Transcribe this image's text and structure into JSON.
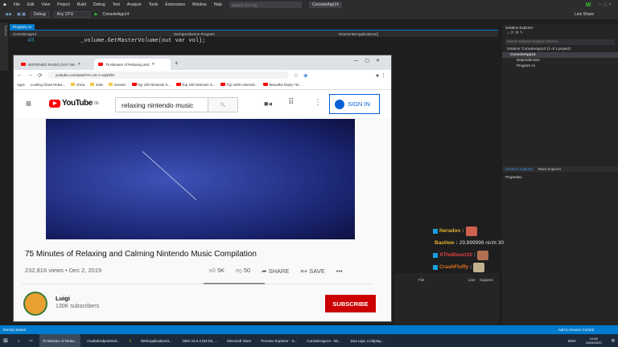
{
  "vs": {
    "menu": [
      "File",
      "Edit",
      "View",
      "Project",
      "Build",
      "Debug",
      "Test",
      "Analyze",
      "Tools",
      "Extensions",
      "Window",
      "Help"
    ],
    "search_placeholder": "Search (Ctrl+Q)",
    "project": "ConsoleApp14",
    "user_initial": "W",
    "live_share": "Live Share",
    "toolbar": {
      "config": "Debug",
      "platform": "Any CPU",
      "run": "ConsoleApp14"
    },
    "doc_tab": "Program.cs",
    "nav": {
      "project": "ConsoleApp14",
      "class": "SetAppVolumne.Program",
      "member": "EnumerateApplications()"
    },
    "code": {
      "line_no": "40",
      "line": "_volume.GetMasterVolume(out var vol);"
    },
    "toolbox": "Toolbox",
    "solution_explorer": {
      "title": "Solution Explorer",
      "search": "Search Solution Explorer (Ctrl+ü)",
      "tree": [
        "Solution 'ConsoleApp14' (1 of 1 project)",
        "ConsoleApp14",
        "Dependencies",
        "Program.cs"
      ],
      "tabs": [
        "Solution Explorer",
        "Team Explorer"
      ]
    },
    "properties": {
      "title": "Properties"
    },
    "error_cols": [
      "File",
      "Line",
      "Suppres"
    ],
    "status": {
      "left": "Item(s) Saved",
      "right": "Add to Source Control"
    }
  },
  "browser": {
    "tabs": [
      "NINTENDO RADIO (24/7 Nin",
      "75 Minutes of Relaxing and"
    ],
    "url": "youtube.com/watch?v=oS-A-wqZ2RI",
    "bookmarks": [
      "Apps",
      "Looking Glass Relea...",
      "china",
      "kelw",
      "session",
      "Top 100 Nintendo S...",
      "Top 100 Nintendo S...",
      "Top 1000 nintendo...",
      "Beautiful Study / W..."
    ]
  },
  "youtube": {
    "logo": "YouTube",
    "region": "DE",
    "search": "relaxing nintendo music",
    "sign_in": "SIGN IN",
    "title": "75 Minutes of Relaxing and Calming Nintendo Music Compilation",
    "views": "232,816 views",
    "date": "Dec 2, 2019",
    "likes": "5K",
    "dislikes": "50",
    "share": "SHARE",
    "save": "SAVE",
    "channel": "Luigi",
    "subscribers": "130K subscribers",
    "subscribe": "SUBSCRIBE"
  },
  "chat": [
    {
      "user": "Neradon",
      "text": "",
      "color": "#e0b030"
    },
    {
      "user": "Bastiwe",
      "text": "29,999998 nicht 30",
      "color": "#e0b030"
    },
    {
      "user": "XTheBeast10",
      "text": "",
      "color": "#e04040"
    },
    {
      "user": "CrashFluffy",
      "text": "",
      "color": "#e07020"
    }
  ],
  "taskbar": {
    "items": [
      "75 Minutes of Relax...",
      "IAudioEndpointVol...",
      "WebApplication11...",
      "OBS 24.0.3 (64-bit, ...",
      "Microsoft Store",
      "Process Explorer - S...",
      "ConsoleApp14 - Mi...",
      "Dua Lipa, Coldplay,..."
    ],
    "lang": "ENG",
    "time": "14:56",
    "date": "13/06/2020"
  }
}
